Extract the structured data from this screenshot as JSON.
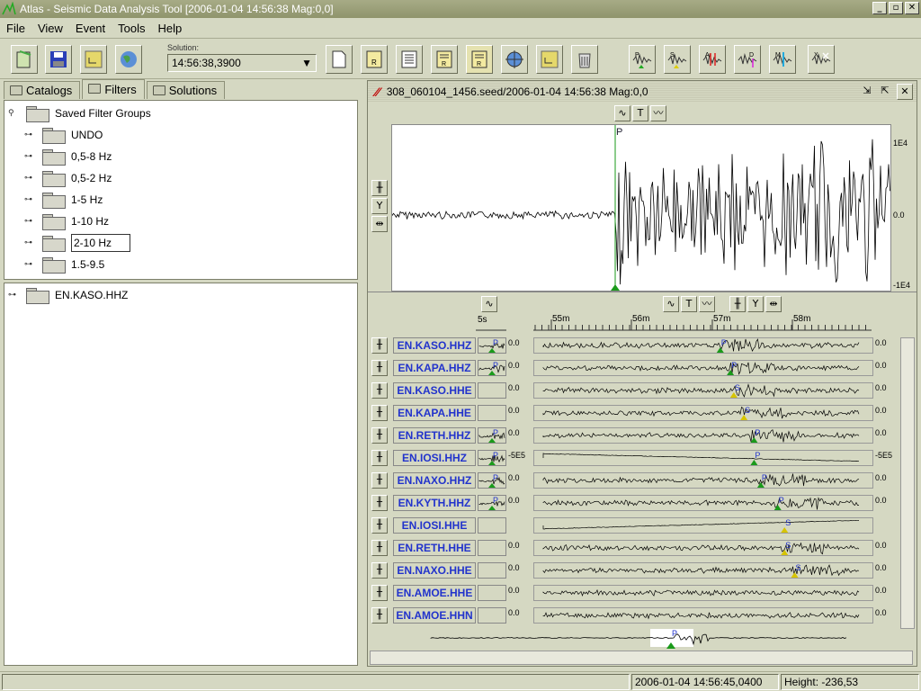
{
  "window": {
    "title": "Atlas - Seismic Data Analysis Tool [2006-01-04 14:56:38 Mag:0,0]"
  },
  "menu": [
    "File",
    "View",
    "Event",
    "Tools",
    "Help"
  ],
  "toolbar": {
    "solution_label": "Solution:",
    "solution_value": "14:56:38,3900",
    "phase_buttons": [
      "P",
      "S",
      "A",
      "D",
      "M",
      "X"
    ]
  },
  "tabs": [
    {
      "label": "Catalogs"
    },
    {
      "label": "Filters"
    },
    {
      "label": "Solutions"
    }
  ],
  "filter_tree": {
    "root": "Saved Filter Groups",
    "items": [
      "UNDO",
      "0,5-8 Hz",
      "0,5-2 Hz",
      "1-5 Hz",
      "1-10 Hz",
      "2-10 Hz",
      "1.5-9.5"
    ],
    "selected": "2-10 Hz"
  },
  "station_tree": {
    "root": "EN.KASO.HHZ"
  },
  "event_panel": {
    "title": "308_060104_1456.seed/2006-01-04 14:56:38 Mag:0,0",
    "main_trace": {
      "y_top": "1E4",
      "y_mid": "0.0",
      "y_bot": "-1E4",
      "pick": "P"
    },
    "time_axis": {
      "zoom_label": "5s",
      "ticks": [
        "55m",
        "56m",
        "57m",
        "58m"
      ]
    },
    "tool_labels": {
      "filter": "∿",
      "text": "T",
      "wave": "〰",
      "grid": "╫",
      "y": "Y",
      "compress": "⇹"
    }
  },
  "traces": [
    {
      "name": "EN.KASO.HHZ",
      "scale_left": "0.0",
      "scale_right": "0.0",
      "phase": "P",
      "pick_pos": 0.55,
      "pick_color": "green"
    },
    {
      "name": "EN.KAPA.HHZ",
      "scale_left": "0.0",
      "scale_right": "0.0",
      "phase": "P",
      "pick_pos": 0.58,
      "pick_color": "green"
    },
    {
      "name": "EN.KASO.HHE",
      "scale_left": "0.0",
      "scale_right": "0.0",
      "phase": "S",
      "pick_pos": 0.59,
      "pick_color": "yellow"
    },
    {
      "name": "EN.KAPA.HHE",
      "scale_left": "0.0",
      "scale_right": "0.0",
      "phase": "S",
      "pick_pos": 0.62,
      "pick_color": "yellow"
    },
    {
      "name": "EN.RETH.HHZ",
      "scale_left": "0.0",
      "scale_right": "0.0",
      "phase": "P",
      "pick_pos": 0.65,
      "pick_color": "green"
    },
    {
      "name": "EN.IOSI.HHZ",
      "scale_left": "-5E5",
      "scale_right": "-5E5",
      "phase": "P",
      "pick_pos": 0.65,
      "pick_color": "green"
    },
    {
      "name": "EN.NAXO.HHZ",
      "scale_left": "0.0",
      "scale_right": "0.0",
      "phase": "P",
      "pick_pos": 0.67,
      "pick_color": "green"
    },
    {
      "name": "EN.KYTH.HHZ",
      "scale_left": "0.0",
      "scale_right": "0.0",
      "phase": "P",
      "pick_pos": 0.72,
      "pick_color": "green"
    },
    {
      "name": "EN.IOSI.HHE",
      "scale_left": "",
      "scale_right": "",
      "phase": "S",
      "pick_pos": 0.74,
      "pick_color": "yellow"
    },
    {
      "name": "EN.RETH.HHE",
      "scale_left": "0.0",
      "scale_right": "0.0",
      "phase": "S",
      "pick_pos": 0.74,
      "pick_color": "yellow"
    },
    {
      "name": "EN.NAXO.HHE",
      "scale_left": "0.0",
      "scale_right": "0.0",
      "phase": "S",
      "pick_pos": 0.77,
      "pick_color": "yellow"
    },
    {
      "name": "EN.AMOE.HHE",
      "scale_left": "0.0",
      "scale_right": "0.0",
      "phase": "",
      "pick_pos": 0,
      "pick_color": ""
    },
    {
      "name": "EN.AMOE.HHN",
      "scale_left": "0.0",
      "scale_right": "0.0",
      "phase": "",
      "pick_pos": 0,
      "pick_color": ""
    }
  ],
  "statusbar": {
    "time": "2006-01-04 14:56:45,0400",
    "height": "Height: -236,53"
  }
}
